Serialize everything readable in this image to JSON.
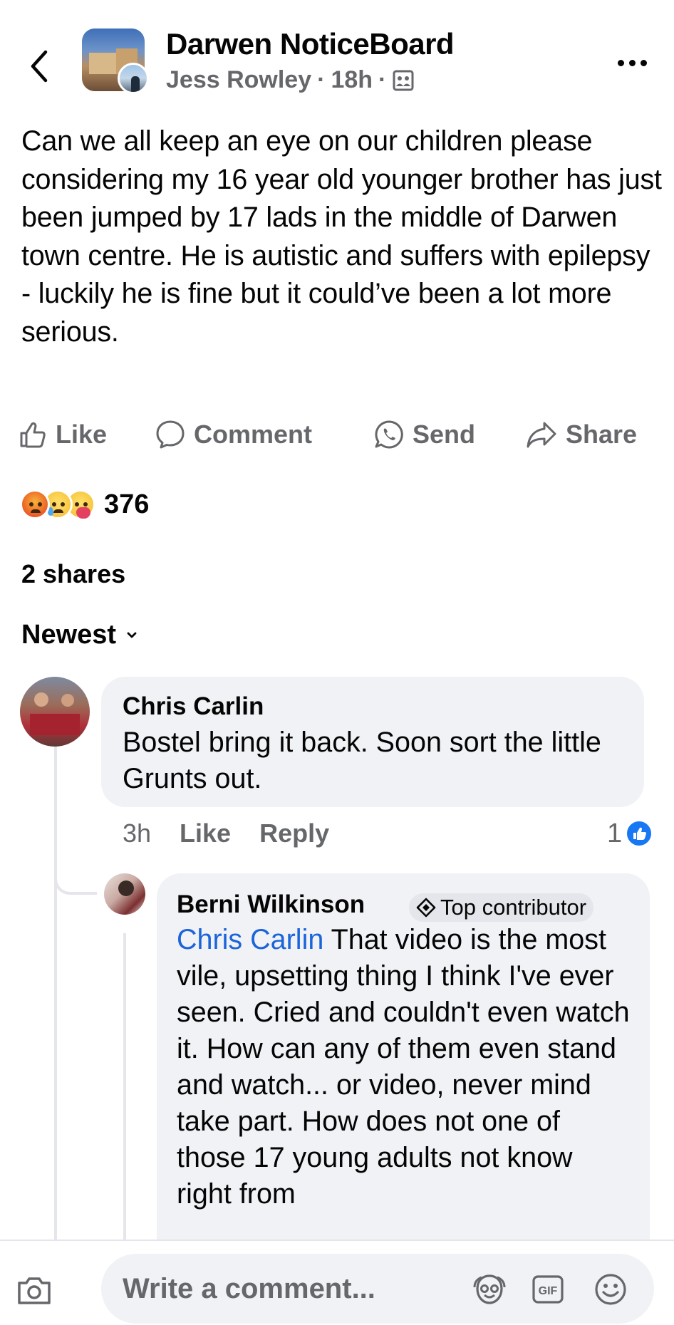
{
  "header": {
    "group_name": "Darwen NoticeBoard",
    "author": "Jess Rowley",
    "separator": "·",
    "time": "18h",
    "privacy_icon": "group-members-icon"
  },
  "post": {
    "text": "Can we all keep an eye on our children please considering my 16 year old younger brother has just been jumped by 17 lads in the middle of Darwen town centre. He is autistic and suffers with epilepsy - luckily he is fine but it could’ve been a lot more serious."
  },
  "actions": {
    "like_label": "Like",
    "comment_label": "Comment",
    "send_label": "Send",
    "share_label": "Share"
  },
  "reactions": {
    "types": [
      "angry",
      "sad",
      "care"
    ],
    "count": "376"
  },
  "shares_label": "2 shares",
  "sort_label": "Newest",
  "comments": [
    {
      "name": "Chris Carlin",
      "text": "Bostel bring it back. Soon sort the little Grunts out.",
      "time": "3h",
      "like_label": "Like",
      "reply_label": "Reply",
      "like_count": "1"
    },
    {
      "name": "Berni Wilkinson",
      "badge": "Top contributor",
      "mention": "Chris Carlin",
      "text": "That video is the most vile, upsetting thing I think I've ever seen. Cried and couldn't even watch it. How can any of them even stand and watch... or video, never mind take part. How does not one of those 17 young adults not know right from"
    }
  ],
  "composer": {
    "placeholder": "Write a comment..."
  },
  "colors": {
    "accent": "#1877f2",
    "mention": "#1b64d9",
    "secondary_text": "#65676b",
    "bubble_bg": "#f0f2f5"
  }
}
